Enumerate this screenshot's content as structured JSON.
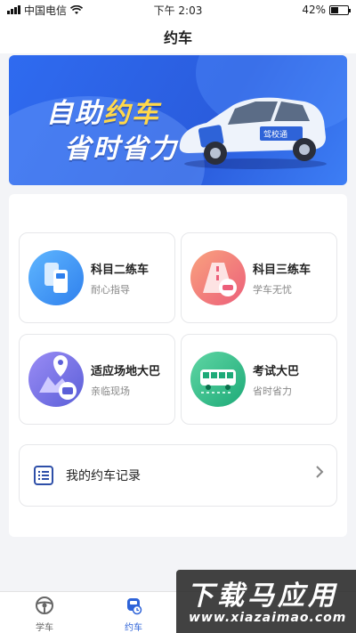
{
  "status_bar": {
    "carrier": "中国电信",
    "time": "下午 2:03",
    "battery": "42%",
    "battery_level": 0.42
  },
  "nav": {
    "title": "约车"
  },
  "banner": {
    "line1_a": "自助",
    "line1_b": "约车",
    "line2": "省时省力",
    "car_label": "驾校通"
  },
  "menu": [
    {
      "title": "科目二练车",
      "subtitle": "耐心指导",
      "icon": "car-parking-icon",
      "color": "#4aa2f5"
    },
    {
      "title": "科目三练车",
      "subtitle": "学车无忧",
      "icon": "road-car-icon",
      "color": "#f07f7f"
    },
    {
      "title": "适应场地大巴",
      "subtitle": "亲临现场",
      "icon": "location-bus-icon",
      "color": "#7a6fe8"
    },
    {
      "title": "考试大巴",
      "subtitle": "省时省力",
      "icon": "bus-icon",
      "color": "#3fc08a"
    }
  ],
  "record": {
    "label": "我的约车记录"
  },
  "tabs": [
    {
      "label": "学车",
      "icon": "steering-wheel-icon"
    },
    {
      "label": "约车",
      "icon": "car-icon"
    }
  ],
  "watermark": {
    "cn": "下载马应用",
    "url": "www.xiazaimao.com"
  }
}
